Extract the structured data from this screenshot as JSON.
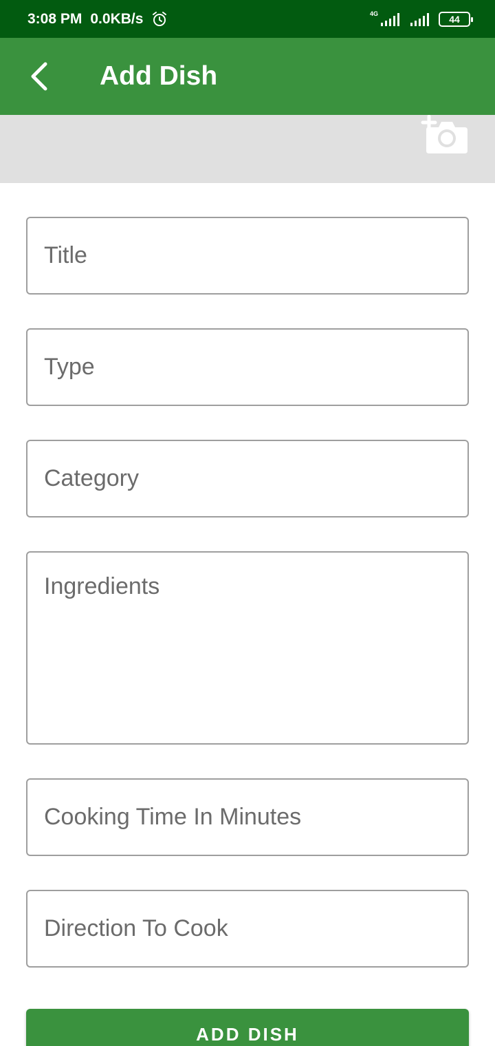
{
  "status_bar": {
    "time": "3:08 PM",
    "network_speed": "0.0KB/s",
    "network_type": "4G",
    "battery": "44",
    "icons": [
      "alarm-icon",
      "signal-icon",
      "signal-icon",
      "battery-icon"
    ]
  },
  "app_bar": {
    "title": "Add Dish",
    "back_icon": "back-arrow-icon",
    "background": "#3a923e"
  },
  "image_picker": {
    "icon": "add-photo-icon",
    "background": "#e0e0e0"
  },
  "form": {
    "title_placeholder": "Title",
    "type_placeholder": "Type",
    "category_placeholder": "Category",
    "ingredients_placeholder": "Ingredients",
    "cooking_time_placeholder": "Cooking Time In Minutes",
    "direction_placeholder": "Direction To Cook",
    "submit_label": "ADD DISH"
  },
  "colors": {
    "status_bar": "#025b10",
    "accent": "#3a923e"
  }
}
